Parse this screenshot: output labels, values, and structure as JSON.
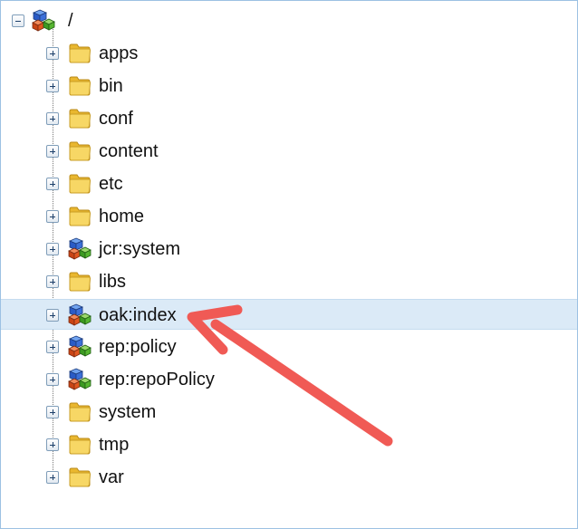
{
  "tree": {
    "root": {
      "label": "/",
      "icon": "node-cubes-icon",
      "expanded": true
    },
    "children": [
      {
        "label": "apps",
        "icon": "folder-icon"
      },
      {
        "label": "bin",
        "icon": "folder-icon"
      },
      {
        "label": "conf",
        "icon": "folder-icon"
      },
      {
        "label": "content",
        "icon": "folder-icon"
      },
      {
        "label": "etc",
        "icon": "folder-icon"
      },
      {
        "label": "home",
        "icon": "folder-icon"
      },
      {
        "label": "jcr:system",
        "icon": "node-cubes-icon"
      },
      {
        "label": "libs",
        "icon": "folder-icon"
      },
      {
        "label": "oak:index",
        "icon": "node-cubes-icon",
        "selected": true
      },
      {
        "label": "rep:policy",
        "icon": "node-cubes-icon"
      },
      {
        "label": "rep:repoPolicy",
        "icon": "node-cubes-icon"
      },
      {
        "label": "system",
        "icon": "folder-icon"
      },
      {
        "label": "tmp",
        "icon": "folder-icon"
      },
      {
        "label": "var",
        "icon": "folder-icon"
      }
    ]
  },
  "annotation": {
    "arrow_color": "#f05a55",
    "points_to": "oak:index"
  },
  "colors": {
    "selection": "#dbeaf7",
    "folder": "#f2c640",
    "border": "#9cc1e3"
  }
}
